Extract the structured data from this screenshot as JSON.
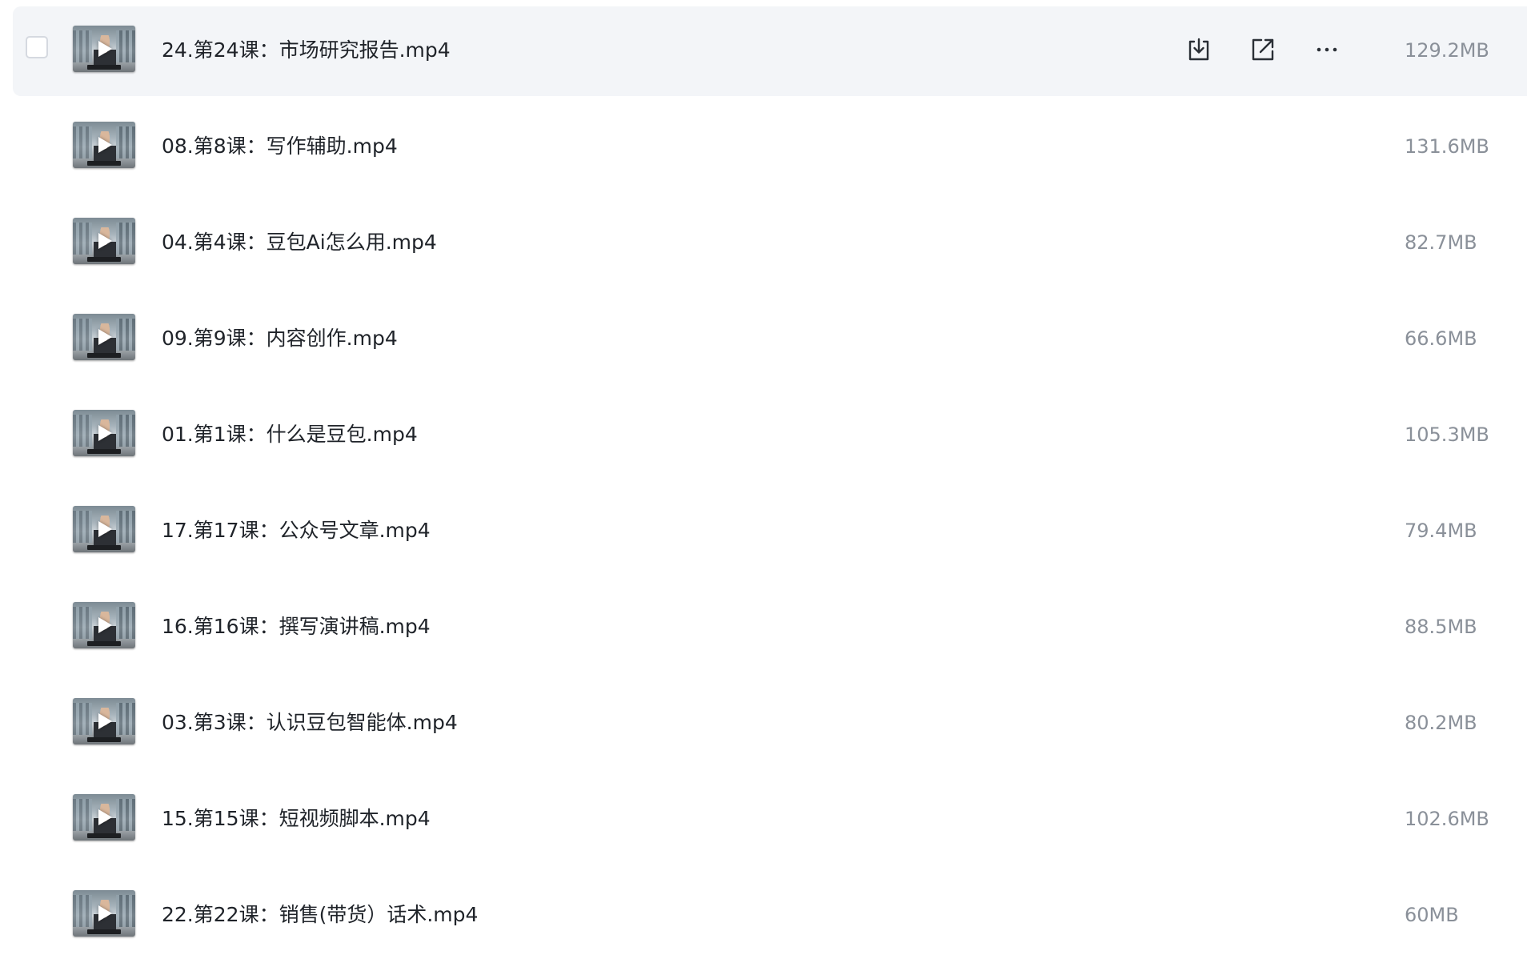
{
  "files": [
    {
      "name": "24.第24课：市场研究报告.mp4",
      "size": "129.2MB",
      "hovered": true
    },
    {
      "name": "08.第8课：写作辅助.mp4",
      "size": "131.6MB"
    },
    {
      "name": "04.第4课：豆包Ai怎么用.mp4",
      "size": "82.7MB"
    },
    {
      "name": "09.第9课：内容创作.mp4",
      "size": "66.6MB"
    },
    {
      "name": "01.第1课：什么是豆包.mp4",
      "size": "105.3MB"
    },
    {
      "name": "17.第17课：公众号文章.mp4",
      "size": "79.4MB"
    },
    {
      "name": "16.第16课：撰写演讲稿.mp4",
      "size": "88.5MB"
    },
    {
      "name": "03.第3课：认识豆包智能体.mp4",
      "size": "80.2MB"
    },
    {
      "name": "15.第15课：短视频脚本.mp4",
      "size": "102.6MB"
    },
    {
      "name": "22.第22课：销售(带货）话术.mp4",
      "size": "60MB"
    }
  ],
  "row_actions": {
    "download_icon": "download-icon",
    "share_icon": "share-icon",
    "more_icon": "more-icon"
  },
  "colors": {
    "hover_row_background": "#f3f5f8",
    "file_name_text": "#1f2329",
    "file_size_text": "#8a9099",
    "icon_stroke": "#2a2f36"
  }
}
